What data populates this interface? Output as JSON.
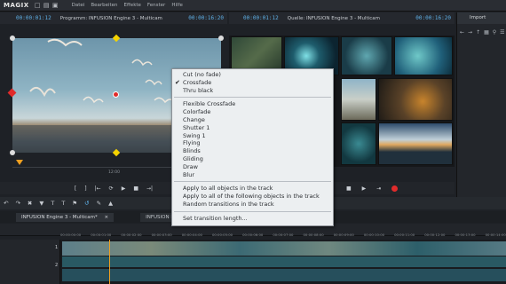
{
  "app": {
    "logo": "MAGIX",
    "menu": [
      "Datei",
      "Bearbeiten",
      "Effekte",
      "Fenster",
      "Hilfe"
    ]
  },
  "program_monitor": {
    "timecode_left": "00:00:01:12",
    "title": "Programm: INFUSION Engine 3 - Multicam",
    "timecode_right": "00:00:16:20",
    "ruler_label": "12:00"
  },
  "source_monitor": {
    "timecode_left": "00:00:01:12",
    "title": "Quelle: INFUSION Engine 3 - Multicam",
    "timecode_right": "00:00:16:20"
  },
  "import_panel": {
    "tab": "Import"
  },
  "transition_menu": {
    "group1": [
      "Cut (no fade)",
      "Crossfade",
      "Thru black"
    ],
    "checked": "Crossfade",
    "group2": [
      "Flexible Crossfade",
      "Colorfade",
      "Change",
      "Shutter 1",
      "Swing 1",
      "Flying",
      "Blinds",
      "Gliding",
      "Draw",
      "Blur"
    ],
    "group3": [
      "Apply to all objects in the track",
      "Apply to all of the following objects in the track",
      "Random transitions in the track"
    ],
    "group4": [
      "Set transition length..."
    ]
  },
  "tabs": {
    "left": "INFUSION Engine 3 - Multicam*",
    "right": "INFUSION E"
  },
  "timeline": {
    "ruler": [
      "00:00:00:00",
      "00:00:01:00",
      "00:00:02:00",
      "00:00:03:00",
      "00:00:04:00",
      "00:00:05:00",
      "00:00:06:00",
      "00:00:07:00",
      "00:00:08:00",
      "00:00:09:00",
      "00:00:10:00",
      "00:00:11:00",
      "00:00:12:00",
      "00:00:13:00",
      "00:00:14:00"
    ],
    "track_numbers": [
      "1",
      "2"
    ]
  },
  "colors": {
    "accent_blue": "#5fb1e8",
    "record_red": "#e02b2b",
    "yellow_handle": "#f5d300"
  }
}
